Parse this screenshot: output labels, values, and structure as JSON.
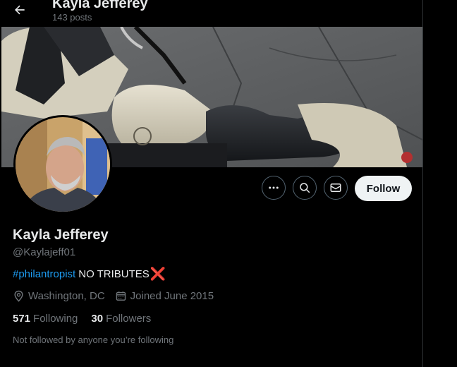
{
  "header": {
    "display_name": "Kayla Jefferey",
    "posts_count": "143 posts"
  },
  "profile": {
    "display_name": "Kayla Jefferey",
    "handle": "@Kaylajeff01",
    "bio_hashtag": "#philantropist",
    "bio_text": "NO TRIBUTES",
    "bio_emoji": "❌",
    "location": "Washington, DC",
    "joined": "Joined June 2015",
    "following_count": "571",
    "following_label": "Following",
    "followers_count": "30",
    "followers_label": "Followers",
    "followed_by_note": "Not followed by anyone you’re following"
  },
  "actions": {
    "follow_label": "Follow"
  },
  "colors": {
    "accent": "#1d9bf0",
    "background": "#000000",
    "muted_text": "#71767b",
    "primary_text": "#e7e9ea",
    "follow_button_bg": "#eff3f4"
  },
  "icons": {
    "back": "arrow-left-icon",
    "more": "more-dots-icon",
    "search": "search-icon",
    "message": "mail-icon",
    "location": "location-pin-icon",
    "joined": "calendar-icon"
  }
}
